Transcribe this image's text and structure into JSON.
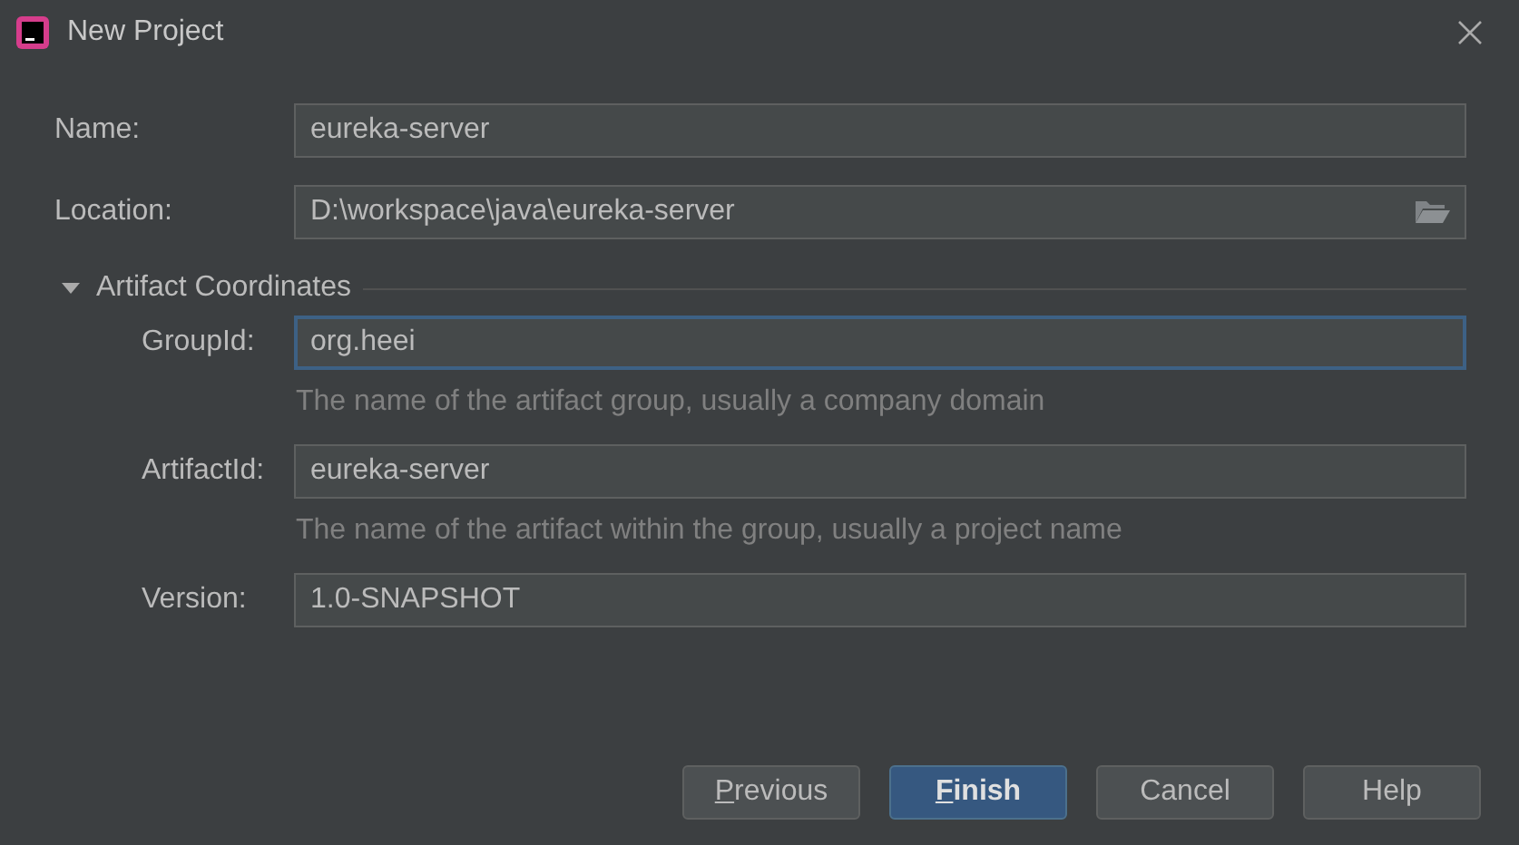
{
  "window": {
    "title": "New Project"
  },
  "fields": [
    {
      "label": "Name:",
      "value": "eureka-server",
      "kind": "text",
      "focused": false
    },
    {
      "label": "Location:",
      "value": "D:\\workspace\\java\\eureka-server",
      "kind": "folder",
      "focused": false
    }
  ],
  "section": {
    "title": "Artifact Coordinates",
    "expanded": true,
    "fields": [
      {
        "label": "GroupId:",
        "value": "org.heei",
        "focused": true,
        "hint": "The name of the artifact group, usually a company domain"
      },
      {
        "label": "ArtifactId:",
        "value": "eureka-server",
        "focused": false,
        "hint": "The name of the artifact within the group, usually a project name"
      },
      {
        "label": "Version:",
        "value": "1.0-SNAPSHOT",
        "focused": false
      }
    ]
  },
  "buttons": [
    {
      "label": "Previous",
      "default": false,
      "mnemonic": true
    },
    {
      "label": "Finish",
      "default": true,
      "mnemonic": true
    },
    {
      "label": "Cancel",
      "default": false,
      "mnemonic": false
    },
    {
      "label": "Help",
      "default": false,
      "mnemonic": false
    }
  ]
}
